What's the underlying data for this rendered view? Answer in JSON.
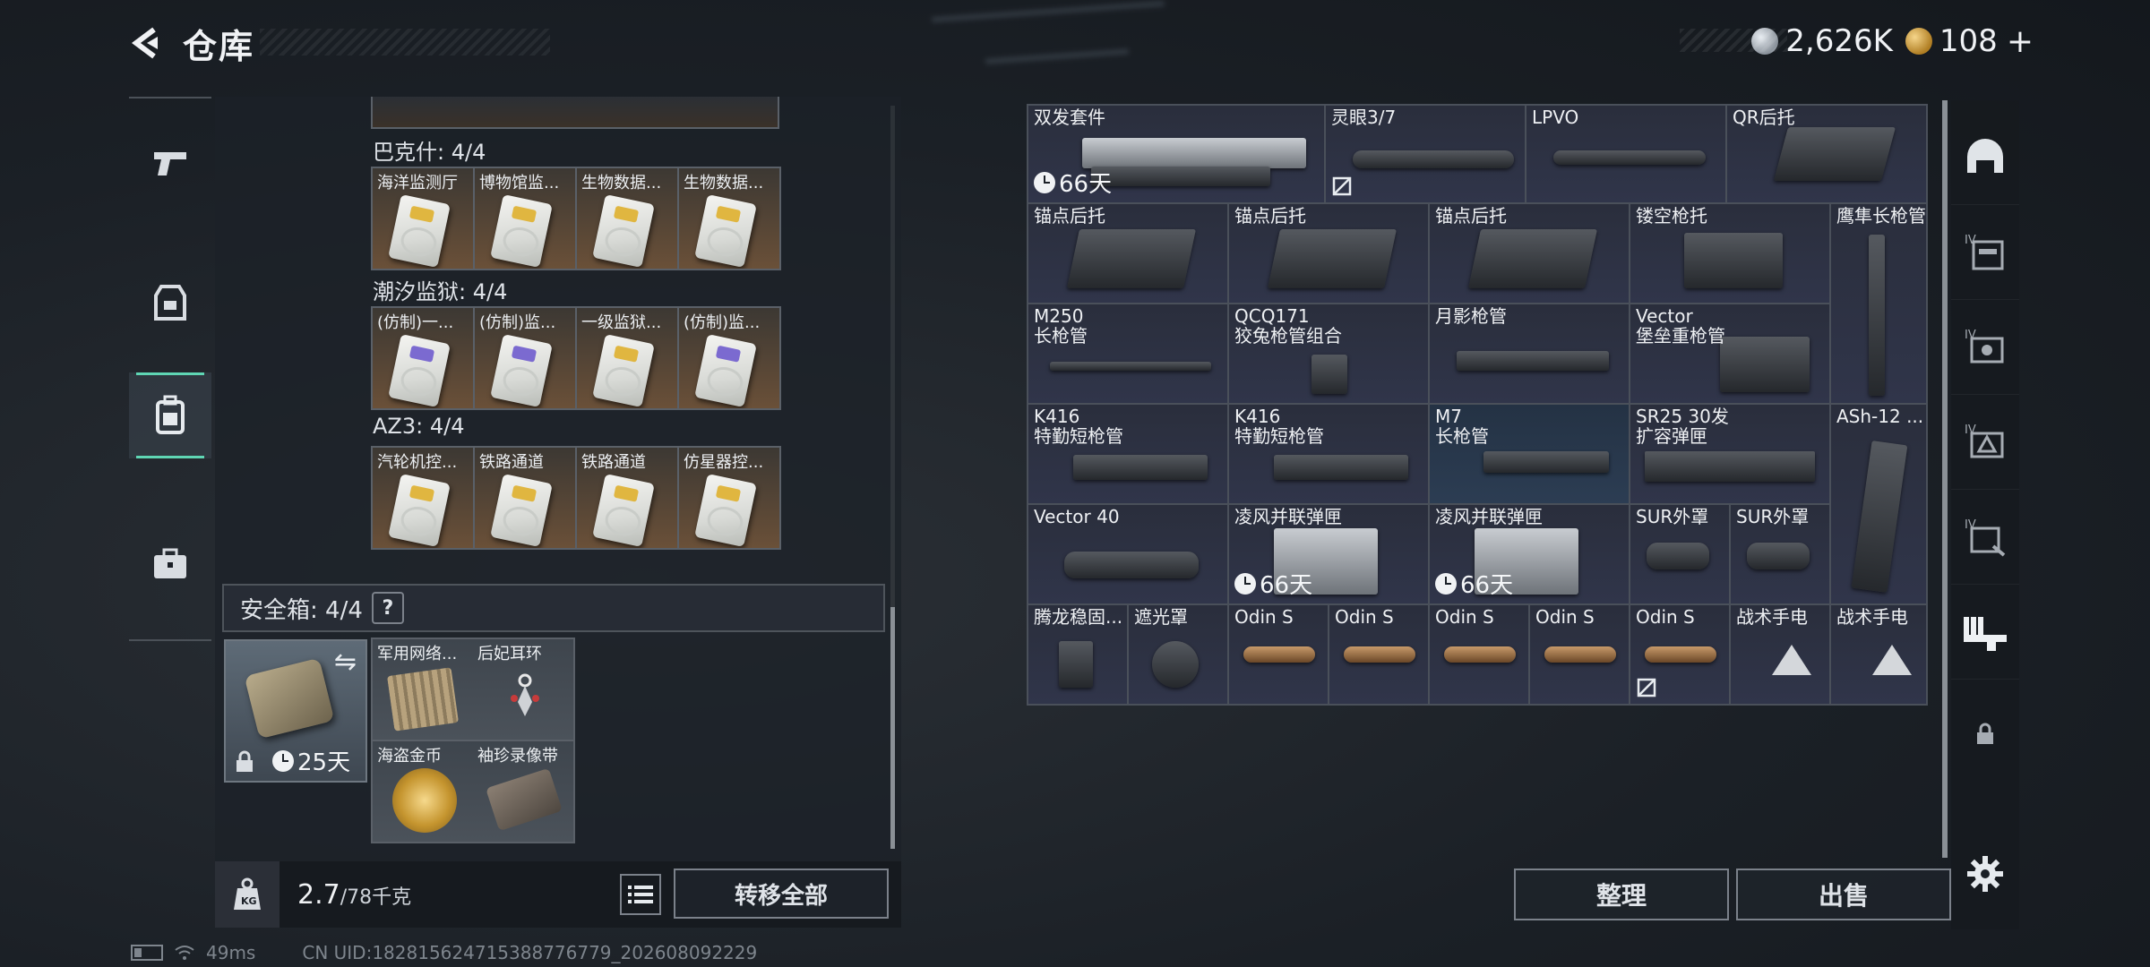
{
  "header": {
    "title": "仓库"
  },
  "currency": {
    "silver": "2,626K",
    "gold": "108",
    "plus": "+"
  },
  "left_nav": {
    "items": [
      {
        "icon": "pistol-icon"
      },
      {
        "icon": "vest-icon"
      },
      {
        "icon": "backpack-icon",
        "active": true
      },
      {
        "icon": "briefcase-icon"
      }
    ]
  },
  "collections": [
    {
      "label": "巴克什: 4/4",
      "items": [
        "海洋监测厅",
        "博物馆监...",
        "生物数据...",
        "生物数据..."
      ]
    },
    {
      "label": "潮汐监狱: 4/4",
      "items": [
        "(仿制)一...",
        "(仿制)监...",
        "一级监狱...",
        "(仿制)监..."
      ]
    },
    {
      "label": "AZ3: 4/4",
      "items": [
        "汽轮机控...",
        "铁路通道",
        "铁路通道",
        "仿星器控..."
      ]
    }
  ],
  "safe_box": {
    "label": "安全箱: 4/4",
    "help": "?",
    "timer": "25天",
    "items": [
      "军用网络...",
      "后妃耳环",
      "海盗金币",
      "袖珍录像带"
    ]
  },
  "bottom_bar": {
    "weight": "2.7",
    "weight_max": "/78千克",
    "transfer_all": "转移全部"
  },
  "status_bar": {
    "ping": "49ms",
    "uid": "CN UID:18281562471538877​6779_202608092229"
  },
  "grid_items": [
    {
      "name": "双发套件",
      "timer": "66天"
    },
    {
      "name": "灵眼3/7"
    },
    {
      "name": "LPVO"
    },
    {
      "name": "QR后托"
    },
    {
      "name": "锚点后托"
    },
    {
      "name": "锚点后托"
    },
    {
      "name": "锚点后托"
    },
    {
      "name": "镂空枪托"
    },
    {
      "name": "鹰隼长枪管"
    },
    {
      "name": "M250\n长枪管"
    },
    {
      "name": "QCQ171\n狡兔枪管组合"
    },
    {
      "name": "月影枪管"
    },
    {
      "name": "Vector\n堡垒重枪管"
    },
    {
      "name": "K416\n特勤短枪管"
    },
    {
      "name": "K416\n特勤短枪管"
    },
    {
      "name": "M7\n长枪管"
    },
    {
      "name": "SR25 30发\n扩容弹匣"
    },
    {
      "name": "ASh-12 ..."
    },
    {
      "name": "Vector 40"
    },
    {
      "name": "凌风并联弹匣",
      "timer": "66天"
    },
    {
      "name": "凌风并联弹匣",
      "timer": "66天"
    },
    {
      "name": "SUR外罩"
    },
    {
      "name": "SUR外罩"
    },
    {
      "name": "腾龙稳固..."
    },
    {
      "name": "遮光罩"
    },
    {
      "name": "Odin S"
    },
    {
      "name": "Odin S"
    },
    {
      "name": "Odin S"
    },
    {
      "name": "Odin S"
    },
    {
      "name": "Odin S"
    },
    {
      "name": "战术手电"
    },
    {
      "name": "战术手电"
    }
  ],
  "right_buttons": {
    "sort": "整理",
    "sell": "出售"
  },
  "right_nav": {
    "items": [
      {
        "icon": "helmet-icon"
      },
      {
        "icon": "armor-tier4-icon",
        "badge": "IV"
      },
      {
        "icon": "weapon-case-tier4-icon",
        "badge": "IV"
      },
      {
        "icon": "triangle-case-tier4-icon",
        "badge": "IV"
      },
      {
        "icon": "tool-case-tier4-icon",
        "badge": "IV"
      },
      {
        "icon": "gun-rack-icon"
      },
      {
        "icon": "lock-icon"
      },
      {
        "icon": "settings-gear-icon"
      }
    ]
  },
  "colors": {
    "accent": "#5fd6b4",
    "cell_bg": "#2c3144",
    "collection_bg": "#6a5038"
  }
}
